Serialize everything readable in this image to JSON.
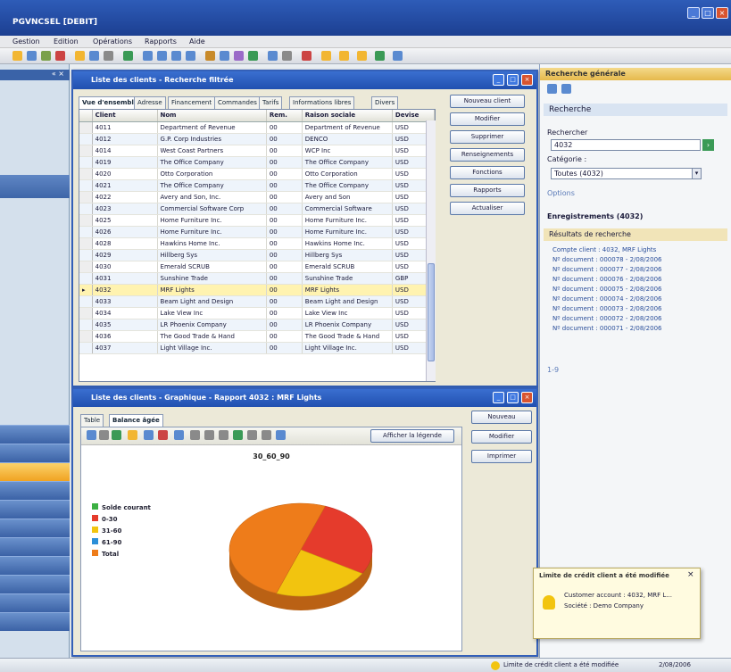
{
  "app": {
    "title": "PGVNCSEL [DEBIT]"
  },
  "menu": [
    "Gestion",
    "Edition",
    "Opérations",
    "Rapports",
    "Aide"
  ],
  "client_window": {
    "title": "Liste des clients - Recherche filtrée",
    "tabs": [
      "Vue d'ensemble",
      "Adresse",
      "Financement",
      "Commandes",
      "Tarifs",
      "Informations libres",
      "Divers"
    ],
    "columns": [
      "Client",
      "Nom",
      "Rem.",
      "Raison sociale",
      "Devise"
    ],
    "rows": [
      [
        "4011",
        "Department of Revenue",
        "00",
        "Department of Revenue",
        "USD"
      ],
      [
        "4012",
        "G.P. Corp Industries",
        "00",
        "DENCO",
        "USD"
      ],
      [
        "4014",
        "West Coast Partners",
        "00",
        "WCP Inc",
        "USD"
      ],
      [
        "4019",
        "The Office Company",
        "00",
        "The Office Company",
        "USD"
      ],
      [
        "4020",
        "Otto Corporation",
        "00",
        "Otto Corporation",
        "USD"
      ],
      [
        "4021",
        "The Office Company",
        "00",
        "The Office Company",
        "USD"
      ],
      [
        "4022",
        "Avery and Son, Inc.",
        "00",
        "Avery and Son",
        "USD"
      ],
      [
        "4023",
        "Commercial Software Corp",
        "00",
        "Commercial Software",
        "USD"
      ],
      [
        "4025",
        "Home Furniture Inc.",
        "00",
        "Home Furniture Inc.",
        "USD"
      ],
      [
        "4026",
        "Home Furniture Inc.",
        "00",
        "Home Furniture Inc.",
        "USD"
      ],
      [
        "4028",
        "Hawkins Home Inc.",
        "00",
        "Hawkins Home Inc.",
        "USD"
      ],
      [
        "4029",
        "Hillberg Sys",
        "00",
        "Hillberg Sys",
        "USD"
      ],
      [
        "4030",
        "Emerald SCRUB",
        "00",
        "Emerald SCRUB",
        "USD"
      ],
      [
        "4031",
        "Sunshine Trade",
        "00",
        "Sunshine Trade",
        "GBP"
      ],
      [
        "4032",
        "MRF Lights",
        "00",
        "MRF Lights",
        "USD"
      ],
      [
        "4033",
        "Beam Light and Design",
        "00",
        "Beam Light and Design",
        "USD"
      ],
      [
        "4034",
        "Lake View Inc",
        "00",
        "Lake View Inc",
        "USD"
      ],
      [
        "4035",
        "LR Phoenix Company",
        "00",
        "LR Phoenix Company",
        "USD"
      ],
      [
        "4036",
        "The Good Trade & Hand",
        "00",
        "The Good Trade & Hand",
        "USD"
      ],
      [
        "4037",
        "Light Village Inc.",
        "00",
        "Light Village Inc.",
        "USD"
      ]
    ],
    "selected_index": 14,
    "buttons": [
      "Nouveau client",
      "Modifier",
      "Supprimer",
      "Renseignements",
      "Fonctions",
      "Rapports",
      "Actualiser"
    ]
  },
  "chart_window": {
    "title": "Liste des clients - Graphique - Rapport 4032 : MRF Lights",
    "tabs": [
      "Table",
      "Balance âgée"
    ],
    "display_label": "Afficher la légende",
    "buttons": [
      "Nouveau",
      "Modifier",
      "Imprimer"
    ]
  },
  "chart_data": {
    "type": "pie",
    "title": "30_60_90",
    "categories": [
      "Solde courant",
      "0-30",
      "31-60",
      "61-90",
      "Total"
    ],
    "values": [
      0,
      28,
      22,
      0,
      50
    ],
    "colors": [
      "#3cb043",
      "#e53b2c",
      "#f2c40f",
      "#2c8fd8",
      "#ee7c1a"
    ]
  },
  "search_panel": {
    "title": "Recherche générale",
    "section": "Recherche",
    "search_label": "Rechercher",
    "search_value": "4032",
    "category_label": "Catégorie :",
    "category_value": "Toutes (4032)",
    "options_label": "Options",
    "result_title": "Enregistrements (4032)",
    "results_header": "Résultats de recherche",
    "results": [
      "Compte client : 4032, MRF Lights",
      "Nº document : 000078 - 2/08/2006",
      "Nº document : 000077 - 2/08/2006",
      "Nº document : 000076 - 2/08/2006",
      "Nº document : 000075 - 2/08/2006",
      "Nº document : 000074 - 2/08/2006",
      "Nº document : 000073 - 2/08/2006",
      "Nº document : 000072 - 2/08/2006",
      "Nº document : 000071 - 2/08/2006"
    ],
    "count": "1-9"
  },
  "notification": {
    "title": "Limite de crédit client a été modifiée",
    "line1": "Customer account : 4032, MRF L...",
    "line2": "Société : Demo Company"
  },
  "statusbar": {
    "text": "Limite de crédit client a été modifiée",
    "date": "2/08/2006"
  }
}
